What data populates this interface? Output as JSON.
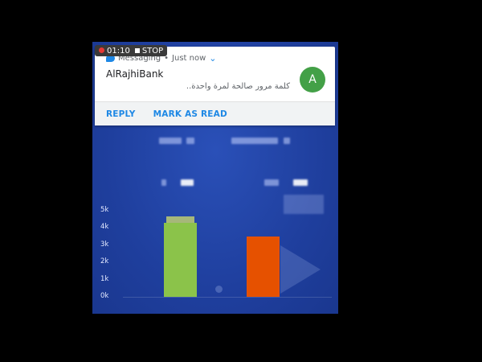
{
  "recording": {
    "time": "01:10",
    "stop_label": "STOP"
  },
  "notification": {
    "app_name": "Messaging",
    "when": "Just now",
    "sender": "AlRajhiBank",
    "message": "كلمة مرور صالحة لمرة واحدة..",
    "avatar_letter": "A",
    "actions": {
      "reply": "REPLY",
      "mark_read": "MARK AS READ"
    }
  },
  "chart_data": {
    "type": "bar",
    "categories": [
      "",
      ""
    ],
    "values": [
      4300,
      3500
    ],
    "colors": [
      "#8bc34a",
      "#e65100"
    ],
    "ylim": [
      0,
      5000
    ],
    "ytick_labels": [
      "0k",
      "1k",
      "2k",
      "3k",
      "4k",
      "5k"
    ]
  }
}
